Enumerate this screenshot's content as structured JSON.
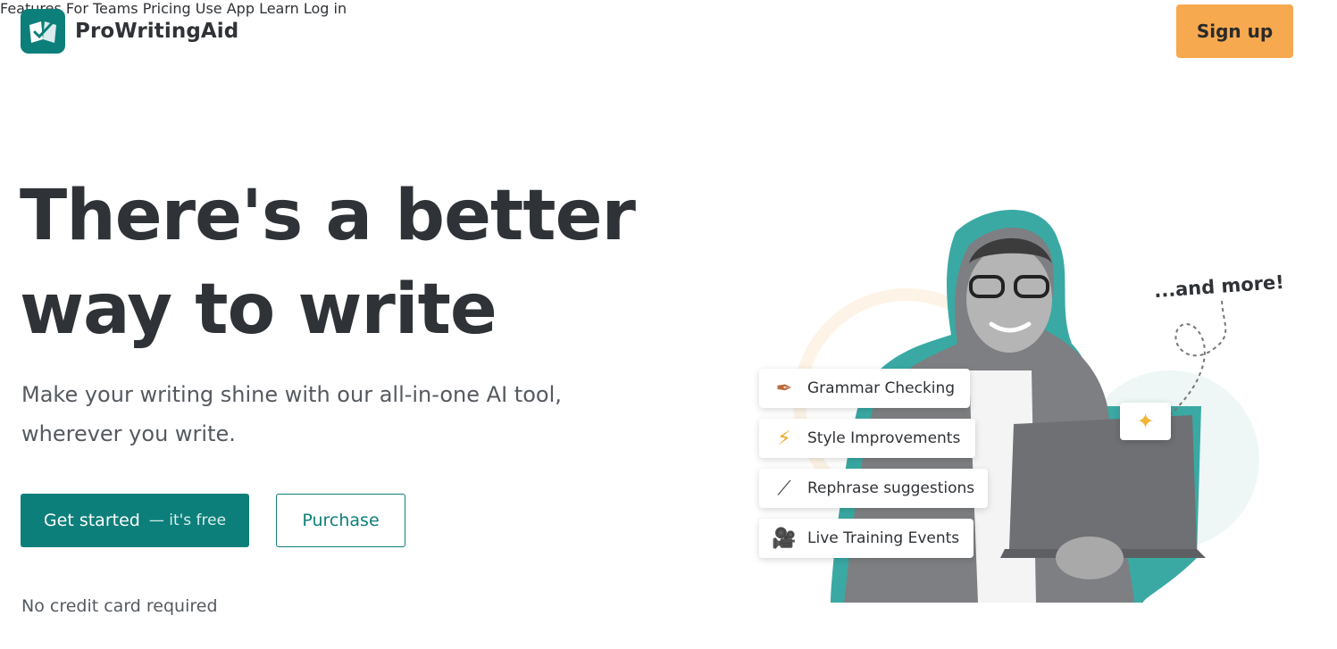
{
  "header": {
    "brand": "ProWritingAid",
    "nav": [
      "Features",
      "For Teams",
      "Pricing",
      "Use App",
      "Learn",
      "Log in"
    ],
    "signup_label": "Sign up"
  },
  "hero": {
    "headline_line1": "There's a better",
    "headline_line2": "way to write",
    "subhead_line1": "Make your writing shine with our all-in-one AI tool,",
    "subhead_line2": "wherever you write.",
    "primary_label": "Get started",
    "primary_sub": "— it's free",
    "secondary_label": "Purchase",
    "note": "No credit card required"
  },
  "illustration": {
    "and_more": "...and more!",
    "features": [
      {
        "icon": "feather-icon",
        "label": "Grammar Checking"
      },
      {
        "icon": "lightning-icon",
        "label": "Style Improvements"
      },
      {
        "icon": "magic-wand-icon",
        "label": "Rephrase suggestions"
      },
      {
        "icon": "video-camera-icon",
        "label": "Live Training Events"
      }
    ]
  },
  "colors": {
    "brand_teal": "#0d7f7a",
    "signup_orange": "#f7a950",
    "text_dark": "#2f3236"
  }
}
